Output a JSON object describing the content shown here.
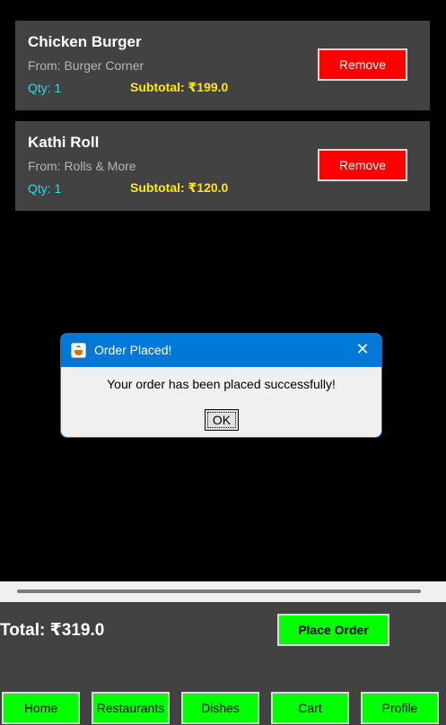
{
  "cart": {
    "items": [
      {
        "name": "Chicken Burger",
        "from": "From: Burger Corner",
        "qty": "Qty: 1",
        "subtotal": "Subtotal: ₹199.0",
        "remove_label": "Remove"
      },
      {
        "name": "Kathi Roll",
        "from": "From: Rolls & More",
        "qty": "Qty: 1",
        "subtotal": "Subtotal: ₹120.0",
        "remove_label": "Remove"
      }
    ]
  },
  "dialog": {
    "title": "Order Placed!",
    "icon": "java-cup-icon",
    "close_glyph": "✕",
    "message": "Your order has been placed successfully!",
    "ok_label": "OK"
  },
  "footer": {
    "total": "Total: ₹319.0",
    "place_order_label": "Place Order"
  },
  "nav": [
    {
      "label": "Home"
    },
    {
      "label": "Restaurants"
    },
    {
      "label": "Dishes"
    },
    {
      "label": "Cart"
    },
    {
      "label": "Profile"
    }
  ],
  "colors": {
    "card_bg": "#424242",
    "remove_bg": "#ff0000",
    "qty_text": "#2fd9e6",
    "subtotal_text": "#ffea00",
    "action_green": "#00ff00",
    "dialog_accent": "#0078d7"
  }
}
